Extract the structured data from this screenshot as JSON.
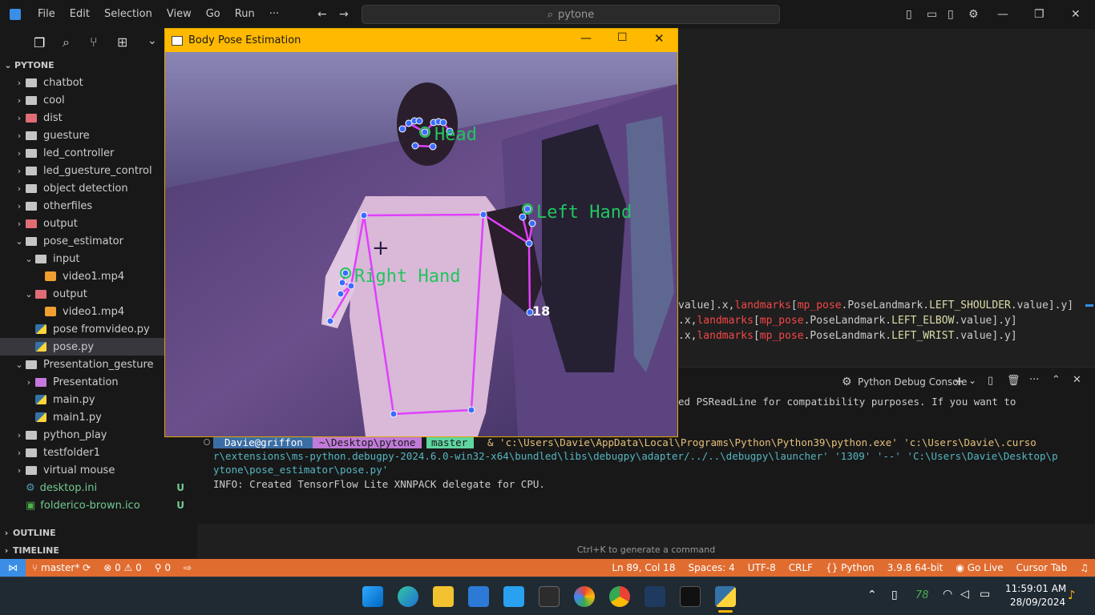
{
  "titlebar": {
    "menu": [
      "File",
      "Edit",
      "Selection",
      "View",
      "Go",
      "Run",
      "···"
    ],
    "search_text": "pytone"
  },
  "sidebar": {
    "root_label": "PYTONE",
    "items": [
      {
        "label": "chatbot",
        "indent": 1,
        "kind": "folder",
        "chev": "›"
      },
      {
        "label": "cool",
        "indent": 1,
        "kind": "folder",
        "chev": "›"
      },
      {
        "label": "dist",
        "indent": 1,
        "kind": "folder-red",
        "chev": "›"
      },
      {
        "label": "guesture",
        "indent": 1,
        "kind": "folder",
        "chev": "›"
      },
      {
        "label": "led_controller",
        "indent": 1,
        "kind": "folder",
        "chev": "›"
      },
      {
        "label": "led_guesture_control",
        "indent": 1,
        "kind": "folder",
        "chev": "›"
      },
      {
        "label": "object detection",
        "indent": 1,
        "kind": "folder",
        "chev": "›"
      },
      {
        "label": "otherfiles",
        "indent": 1,
        "kind": "folder",
        "chev": "›"
      },
      {
        "label": "output",
        "indent": 1,
        "kind": "folder-red",
        "chev": "›"
      },
      {
        "label": "pose_estimator",
        "indent": 1,
        "kind": "folder",
        "chev": "⌄"
      },
      {
        "label": "input",
        "indent": 2,
        "kind": "folder",
        "chev": "⌄"
      },
      {
        "label": "video1.mp4",
        "indent": 3,
        "kind": "video",
        "chev": ""
      },
      {
        "label": "output",
        "indent": 2,
        "kind": "folder-red",
        "chev": "⌄"
      },
      {
        "label": "video1.mp4",
        "indent": 3,
        "kind": "video",
        "chev": ""
      },
      {
        "label": "pose fromvideo.py",
        "indent": 2,
        "kind": "py",
        "chev": ""
      },
      {
        "label": "pose.py",
        "indent": 2,
        "kind": "py",
        "chev": "",
        "selected": true
      },
      {
        "label": "Presentation_gesture",
        "indent": 1,
        "kind": "folder",
        "chev": "⌄"
      },
      {
        "label": "Presentation",
        "indent": 2,
        "kind": "folder-purple",
        "chev": "›"
      },
      {
        "label": "main.py",
        "indent": 2,
        "kind": "py",
        "chev": ""
      },
      {
        "label": "main1.py",
        "indent": 2,
        "kind": "py",
        "chev": ""
      },
      {
        "label": "python_play",
        "indent": 1,
        "kind": "folder",
        "chev": "›"
      },
      {
        "label": "testfolder1",
        "indent": 1,
        "kind": "folder",
        "chev": "›"
      },
      {
        "label": "virtual mouse",
        "indent": 1,
        "kind": "folder",
        "chev": "›"
      },
      {
        "label": "desktop.ini",
        "indent": 1,
        "kind": "gear",
        "chev": "",
        "badge": "U"
      },
      {
        "label": "folderico-brown.ico",
        "indent": 1,
        "kind": "ico",
        "chev": "",
        "badge": "U"
      }
    ],
    "outline_label": "OUTLINE",
    "timeline_label": "TIMELINE"
  },
  "editor": {
    "lines": [
      {
        "a": "value].x,",
        "b": "landmarks",
        "c": "[",
        "d": "mp_pose",
        "e": ".PoseLandmark.",
        "f": "LEFT_SHOULDER",
        "g": ".value].y]"
      },
      {
        "a": ".x,",
        "b": "landmarks",
        "c": "[",
        "d": "mp_pose",
        "e": ".PoseLandmark.",
        "f": "LEFT_ELBOW",
        "g": ".value].y]"
      },
      {
        "a": ".x,",
        "b": "landmarks",
        "c": "[",
        "d": "mp_pose",
        "e": ".PoseLandmark.",
        "f": "LEFT_WRIST",
        "g": ".value].y]"
      }
    ]
  },
  "panel": {
    "console_label": "Python Debug Console",
    "line1": "ed PSReadLine for compatibility purposes. If you want to",
    "prompt_user": "Davie@griffon",
    "prompt_path": "~\\Desktop\\pytone",
    "prompt_branch": "master",
    "cmd1": "& 'c:\\Users\\Davie\\AppData\\Local\\Programs\\Python\\Python39\\python.exe' 'c:\\Users\\Davie\\.curso",
    "cmd2": "r\\extensions\\ms-python.debugpy-2024.6.0-win32-x64\\bundled\\libs\\debugpy\\adapter/../..\\debugpy\\launcher' '1309' '--' 'C:\\Users\\Davie\\Desktop\\p",
    "cmd3": "ytone\\pose_estimator\\pose.py'",
    "info": "INFO: Created TensorFlow Lite XNNPACK delegate for CPU."
  },
  "hint": "Ctrl+K to generate a command",
  "statusbar": {
    "branch": "master*",
    "errors": "0",
    "warnings": "0",
    "ports": "0",
    "position": "Ln 89, Col 18",
    "spaces": "Spaces: 4",
    "encoding": "UTF-8",
    "eol": "CRLF",
    "language": "Python",
    "version": "3.9.8 64-bit",
    "golive": "Go Live",
    "cursortab": "Cursor Tab"
  },
  "cvwindow": {
    "title": "Body Pose Estimation",
    "label_head": "Head",
    "label_left": "Left Hand",
    "label_right": "Right Hand",
    "label_num": "18"
  },
  "taskbar": {
    "battery": "78",
    "time": "11:59:01 AM",
    "date": "28/09/2024"
  },
  "colors": {
    "statusbar": "#e06c30",
    "cv_title": "#ffb900",
    "skeleton": "#e040fb",
    "joint": "#3b6cff",
    "label_green": "#22c55e"
  }
}
